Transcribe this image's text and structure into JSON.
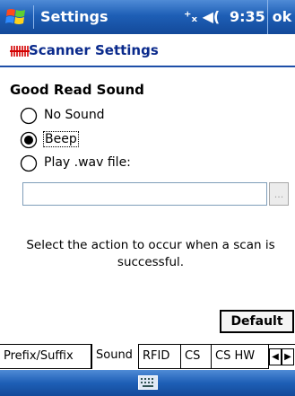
{
  "titlebar": {
    "title": "Settings",
    "clock": "9:35",
    "ok": "ok",
    "status_icons": "⁺ₓ ◀("
  },
  "header": {
    "title": "Scanner Settings",
    "icon": "scanner-icon"
  },
  "group": {
    "label": "Good Read Sound"
  },
  "options": [
    {
      "label": "No Sound",
      "selected": false
    },
    {
      "label": "Beep",
      "selected": true
    },
    {
      "label": "Play .wav file:",
      "selected": false
    }
  ],
  "wav_field": {
    "value": ""
  },
  "browse_button": {
    "label": "..."
  },
  "help_text": "Select the action to occur when a scan is successful.",
  "default_button": {
    "label": "Default"
  },
  "tabs": [
    {
      "label": "Prefix/Suffix",
      "selected": false
    },
    {
      "label": "Sound",
      "selected": true
    },
    {
      "label": "RFID",
      "selected": false
    },
    {
      "label": "CS",
      "selected": false
    },
    {
      "label": "CS HW",
      "selected": false
    }
  ],
  "tab_scroll": {
    "left": "◀",
    "right": "▶"
  },
  "colors": {
    "titlebar": "#1e5fb6",
    "header_text": "#0a2a8c",
    "header_line": "#1e4ea8"
  }
}
